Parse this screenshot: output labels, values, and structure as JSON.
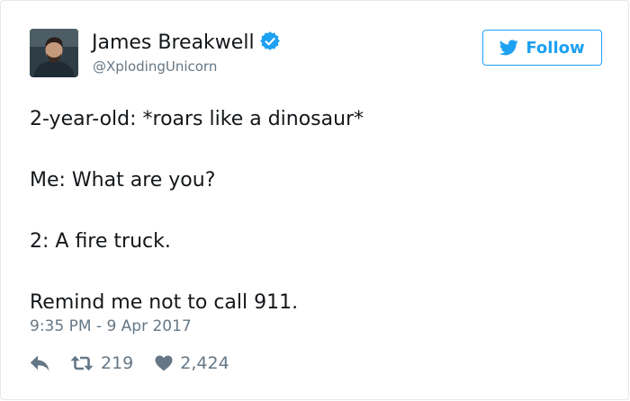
{
  "author": {
    "name": "James Breakwell",
    "handle": "@XplodingUnicorn",
    "verified": true
  },
  "follow": {
    "label": "Follow"
  },
  "tweet": {
    "lines": [
      "2-year-old: *roars like a dinosaur*",
      "Me: What are you?",
      "2: A fire truck.",
      "Remind me not to call 911."
    ],
    "timestamp": "9:35 PM - 9 Apr 2017"
  },
  "stats": {
    "retweets": "219",
    "likes": "2,424"
  },
  "icons": {
    "verified": "verified-badge-icon",
    "follow": "twitter-bird-icon",
    "reply": "reply-arrow-icon",
    "retweet": "retweet-icon",
    "like": "heart-icon"
  },
  "colors": {
    "accent": "#1da1f2",
    "text": "#14171a",
    "muted": "#657786",
    "border": "#e1e8ed"
  }
}
